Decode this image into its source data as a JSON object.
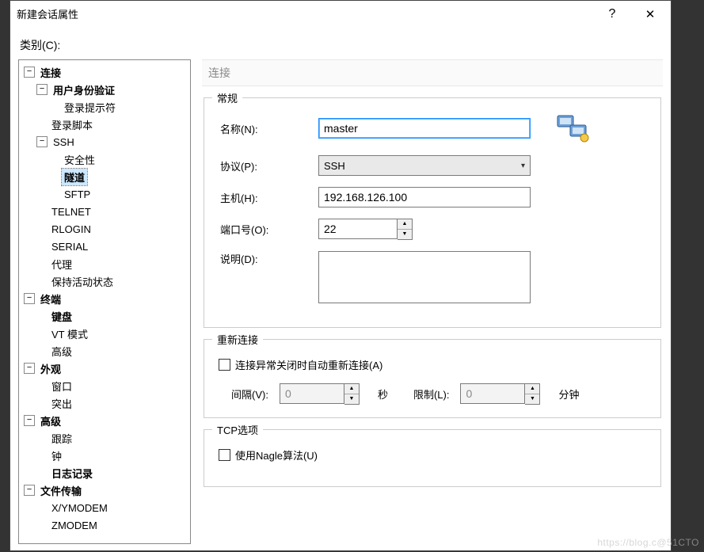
{
  "window": {
    "title": "新建会话属性",
    "help_label": "?",
    "close_label": "✕"
  },
  "category_label": "类别(C):",
  "tree": {
    "connection": "连接",
    "auth": "用户身份验证",
    "login_prompt": "登录提示符",
    "login_script": "登录脚本",
    "ssh": "SSH",
    "security": "安全性",
    "tunnel": "隧道",
    "sftp": "SFTP",
    "telnet": "TELNET",
    "rlogin": "RLOGIN",
    "serial": "SERIAL",
    "proxy": "代理",
    "keepalive": "保持活动状态",
    "terminal": "终端",
    "keyboard": "键盘",
    "vtmode": "VT 模式",
    "adv_term": "高级",
    "appearance": "外观",
    "window": "窗口",
    "highlight": "突出",
    "advanced": "高级",
    "trace": "跟踪",
    "bell": "钟",
    "logging": "日志记录",
    "file_transfer": "文件传输",
    "xymodem": "X/YMODEM",
    "zmodem": "ZMODEM"
  },
  "panel": {
    "header": "连接",
    "general": {
      "legend": "常规",
      "name_label": "名称(N):",
      "name_value": "master",
      "protocol_label": "协议(P):",
      "protocol_value": "SSH",
      "host_label": "主机(H):",
      "host_value": "192.168.126.100",
      "port_label": "端口号(O):",
      "port_value": "22",
      "desc_label": "说明(D):",
      "desc_value": ""
    },
    "reconnect": {
      "legend": "重新连接",
      "auto_label": "连接异常关闭时自动重新连接(A)",
      "interval_label": "间隔(V):",
      "interval_value": "0",
      "interval_unit": "秒",
      "limit_label": "限制(L):",
      "limit_value": "0",
      "limit_unit": "分钟"
    },
    "tcp": {
      "legend": "TCP选项",
      "nagle_label": "使用Nagle算法(U)"
    }
  },
  "watermark": "https://blog.c@51CTO"
}
